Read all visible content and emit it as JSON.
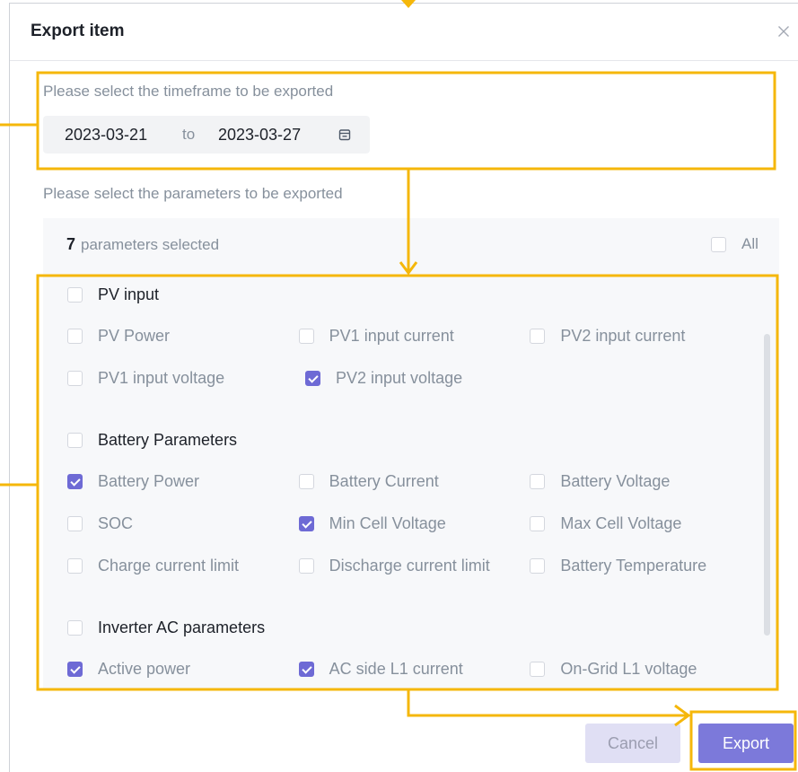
{
  "dialog": {
    "title": "Export item",
    "close_icon": "close-icon"
  },
  "timeframe": {
    "label": "Please select the timeframe to be exported",
    "start_date": "2023-03-21",
    "separator": "to",
    "end_date": "2023-03-27",
    "calendar_icon": "calendar-icon"
  },
  "parameters": {
    "label": "Please select the parameters to be exported",
    "selected_count": "7",
    "selected_text": "parameters selected",
    "all_label": "All",
    "all_checked": false,
    "groups": [
      {
        "name": "PV input",
        "checked": false,
        "items": [
          {
            "label": "PV Power",
            "checked": false
          },
          {
            "label": "PV1 input current",
            "checked": false
          },
          {
            "label": "PV2 input current",
            "checked": false
          },
          {
            "label": "PV1 input voltage",
            "checked": false
          },
          {
            "label": "PV2 input voltage",
            "checked": true
          }
        ]
      },
      {
        "name": "Battery Parameters",
        "checked": false,
        "items": [
          {
            "label": "Battery Power",
            "checked": true
          },
          {
            "label": "Battery Current",
            "checked": false
          },
          {
            "label": "Battery Voltage",
            "checked": false
          },
          {
            "label": "SOC",
            "checked": false
          },
          {
            "label": "Min Cell Voltage",
            "checked": true
          },
          {
            "label": "Max Cell Voltage",
            "checked": false
          },
          {
            "label": "Charge current limit",
            "checked": false
          },
          {
            "label": "Discharge current limit",
            "checked": false
          },
          {
            "label": "Battery Temperature",
            "checked": false
          }
        ]
      },
      {
        "name": "Inverter AC parameters",
        "checked": false,
        "items": [
          {
            "label": "Active power",
            "checked": true
          },
          {
            "label": "AC side L1 current",
            "checked": true
          },
          {
            "label": "On-Grid L1 voltage",
            "checked": false
          }
        ]
      }
    ]
  },
  "footer": {
    "cancel_label": "Cancel",
    "export_label": "Export"
  },
  "colors": {
    "accent": "#6e6ad5",
    "primary_button": "#7c79da",
    "annotation": "#f5b70a",
    "text_primary": "#1d2129",
    "text_secondary": "#86909c"
  }
}
